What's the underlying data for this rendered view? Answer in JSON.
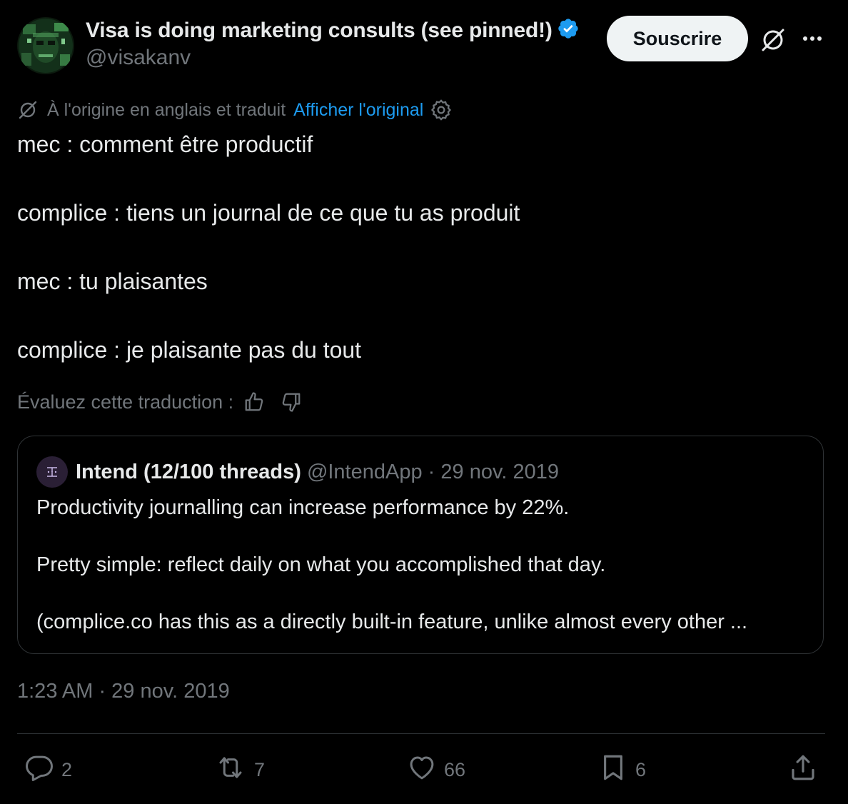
{
  "author": {
    "display_name": "Visa is doing marketing consults (see pinned!)",
    "handle": "@visakanv",
    "verified": true,
    "avatar_icon": "profile-photo"
  },
  "header_actions": {
    "subscribe_label": "Souscrire",
    "grok_icon": "grok-icon",
    "more_icon": "more-icon"
  },
  "translation": {
    "note": "À l'origine en anglais et traduit",
    "show_original": "Afficher l'original",
    "settings_icon": "gear-icon"
  },
  "tweet_text": [
    "mec : comment être productif",
    "complice : tiens un journal de ce que tu as produit",
    "mec : tu plaisantes",
    "complice : je plaisante pas du tout"
  ],
  "rate_translation": {
    "label": "Évaluez cette traduction :",
    "up_icon": "thumbs-up-icon",
    "down_icon": "thumbs-down-icon"
  },
  "quote": {
    "name": "Intend (12/100 threads)",
    "handle": "@IntendApp",
    "separator": "·",
    "date": "29 nov. 2019",
    "lines": [
      "Productivity journalling can increase performance by 22%.",
      "Pretty simple: reflect daily on what you accomplished that day.",
      "(complice.co has this as a directly built-in feature, unlike almost every other ..."
    ]
  },
  "timestamp": "1:23 AM · 29 nov. 2019",
  "actions": {
    "replies": "2",
    "retweets": "7",
    "likes": "66",
    "bookmarks": "6"
  },
  "colors": {
    "background": "#000000",
    "text": "#e7e9ea",
    "secondary": "#71767b",
    "accent": "#1d9bf0",
    "border": "#2f3336",
    "button_bg": "#eff3f4"
  }
}
